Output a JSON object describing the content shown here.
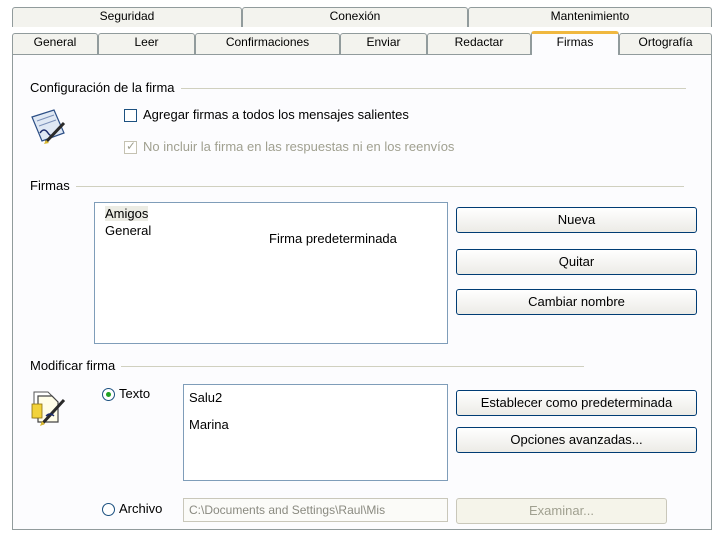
{
  "tabs_row1": [
    {
      "label": "Seguridad"
    },
    {
      "label": "Conexión"
    },
    {
      "label": "Mantenimiento"
    }
  ],
  "tabs_row2": [
    {
      "label": "General"
    },
    {
      "label": "Leer"
    },
    {
      "label": "Confirmaciones"
    },
    {
      "label": "Enviar"
    },
    {
      "label": "Redactar"
    },
    {
      "label": "Firmas"
    },
    {
      "label": "Ortografía"
    }
  ],
  "active_tab": "Firmas",
  "config": {
    "title": "Configuración de la firma",
    "add_all_label": "Agregar firmas a todos los mensajes salientes",
    "add_all_checked": false,
    "no_reply_label": "No incluir la firma en las respuestas ni en los reenvíos",
    "no_reply_checked": true,
    "no_reply_check_glyph": "✓"
  },
  "signatures": {
    "title": "Firmas",
    "items": [
      {
        "name": "Amigos",
        "note": ""
      },
      {
        "name": "General",
        "note": "Firma predeterminada"
      }
    ],
    "selected_index": 0,
    "new_button": "Nueva",
    "remove_button": "Quitar",
    "rename_button": "Cambiar nombre"
  },
  "edit": {
    "title": "Modificar firma",
    "text_option": "Texto",
    "text_selected": true,
    "text_line1": "Salu2",
    "text_line2": "Marina",
    "file_option": "Archivo",
    "file_path": "C:\\Documents and Settings\\Raul\\Mis",
    "set_default_button": "Establecer como predeterminada",
    "advanced_button": "Opciones avanzadas...",
    "browse_button": "Examinar..."
  },
  "icons": {
    "config": "pen-signature-icon",
    "edit": "document-pen-icon"
  }
}
